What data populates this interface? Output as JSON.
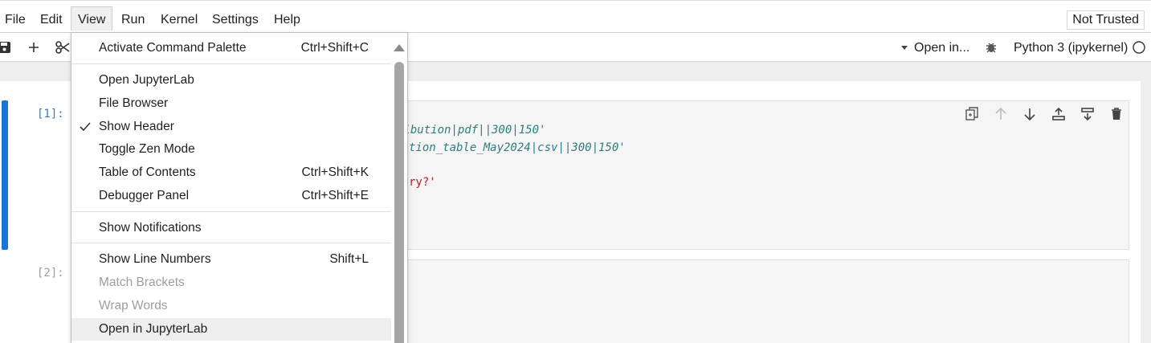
{
  "menubar": {
    "items": [
      "File",
      "Edit",
      "View",
      "Run",
      "Kernel",
      "Settings",
      "Help"
    ],
    "active": "View",
    "trust_status": "Not Trusted"
  },
  "toolbar": {
    "open_in": "Open in...",
    "kernel_name": "Python 3 (ipykernel)"
  },
  "cells": [
    {
      "prompt": "[1]:",
      "lines": [
        "ribution|pdf||300|150'",
        "tion_table_May2024|csv||300|150'",
        "ry?'"
      ]
    },
    {
      "prompt": "[2]:",
      "lines": []
    }
  ],
  "view_menu": {
    "items": [
      {
        "label": "Activate Command Palette",
        "shortcut": "Ctrl+Shift+C"
      },
      {
        "label": "Open JupyterLab",
        "shortcut": ""
      },
      {
        "label": "File Browser",
        "shortcut": ""
      },
      {
        "label": "Show Header",
        "shortcut": "",
        "checked": true
      },
      {
        "label": "Toggle Zen Mode",
        "shortcut": ""
      },
      {
        "label": "Table of Contents",
        "shortcut": "Ctrl+Shift+K"
      },
      {
        "label": "Debugger Panel",
        "shortcut": "Ctrl+Shift+E"
      },
      {
        "label": "Show Notifications",
        "shortcut": ""
      },
      {
        "label": "Show Line Numbers",
        "shortcut": "Shift+L"
      },
      {
        "label": "Match Brackets",
        "shortcut": "",
        "disabled": true
      },
      {
        "label": "Wrap Words",
        "shortcut": "",
        "disabled": true
      },
      {
        "label": "Open in JupyterLab",
        "shortcut": "",
        "hovered": true
      }
    ]
  },
  "colors": {
    "accent": "#1976d2",
    "prompt_active": "#307fc1",
    "code_variable": "#2e7d7d",
    "code_string": "#b22222"
  }
}
